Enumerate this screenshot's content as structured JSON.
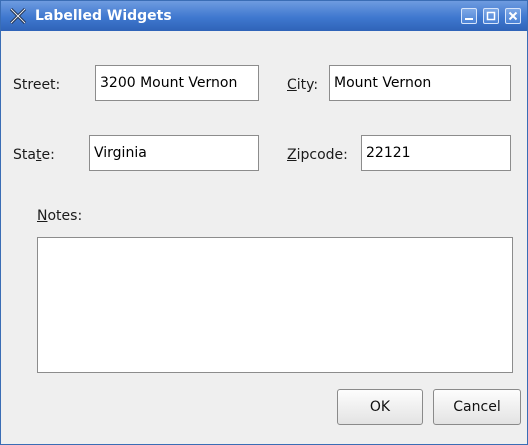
{
  "window": {
    "title": "Labelled Widgets",
    "icon": "x-app-icon"
  },
  "form": {
    "street_label": "Street:",
    "street_value": "3200 Mount Vernon",
    "city_label_mn": "C",
    "city_label_rest": "ity:",
    "city_value": "Mount Vernon",
    "state_label_pre": "Sta",
    "state_label_mn": "t",
    "state_label_post": "e:",
    "state_value": "Virginia",
    "zip_label_mn": "Z",
    "zip_label_rest": "ipcode:",
    "zip_value": "22121",
    "notes_label_mn": "N",
    "notes_label_rest": "otes:",
    "notes_value": ""
  },
  "buttons": {
    "ok": "OK",
    "cancel": "Cancel"
  },
  "colors": {
    "titlebar": "#3f78cf",
    "background": "#efefef"
  }
}
